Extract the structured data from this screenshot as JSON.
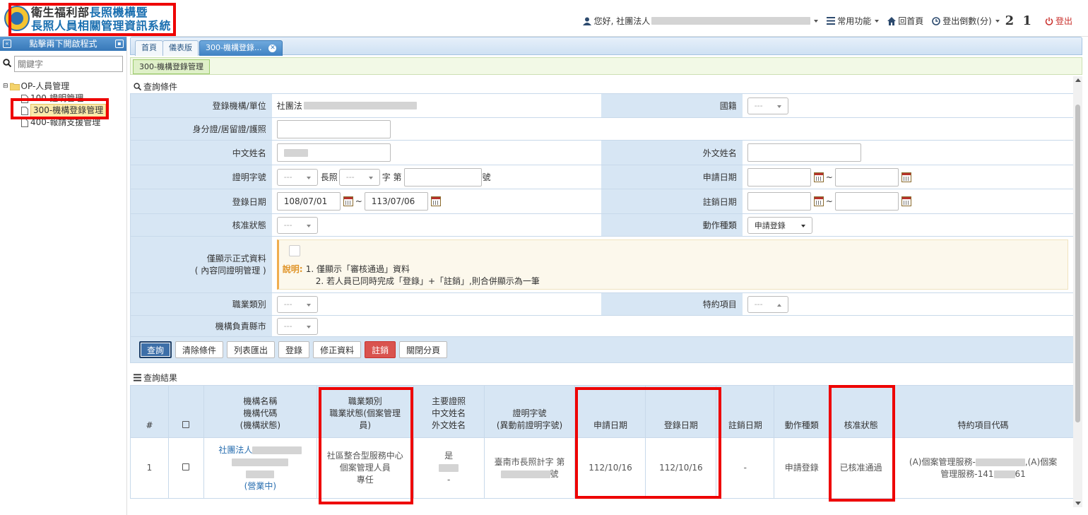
{
  "app": {
    "title_line1_a": "衛生福利部",
    "title_line1_b": "長照機構暨",
    "title_line2": "長照人員相關管理資訊系統"
  },
  "topnav": {
    "greeting": "您好, 社團法人",
    "common_functions": "常用功能",
    "home": "回首頁",
    "logout_countdown_label": "登出倒數(分)",
    "countdown": "2 1",
    "logout": "登出"
  },
  "sidebar": {
    "header": "點擊兩下開啟程式",
    "search_placeholder": "關鍵字",
    "tree": [
      {
        "label": "OP-人員管理"
      },
      {
        "label": "100-證明管理"
      },
      {
        "label": "300-機構登錄管理"
      },
      {
        "label": "400-報請支援管理"
      }
    ]
  },
  "tabs": [
    {
      "label": "首頁"
    },
    {
      "label": "儀表版"
    },
    {
      "label": "300-機構登錄..."
    }
  ],
  "subtab": "300-機構登錄管理",
  "query_section_title": "查詢條件",
  "form": {
    "org_label": "登錄機構/單位",
    "org_value_prefix": "社團法",
    "nationality_label": "國籍",
    "id_label": "身分證/居留證/護照",
    "cname_label": "中文姓名",
    "fname_label": "外文姓名",
    "cert_label": "證明字號",
    "cert_longzhao": "長照",
    "cert_zi": "字 第",
    "cert_hao": "號",
    "apply_date_label": "申請日期",
    "reg_date_label": "登錄日期",
    "reg_date_from": "108/07/01",
    "reg_date_to": "113/07/06",
    "cancel_date_label": "註銷日期",
    "approval_label": "核准狀態",
    "action_type_label": "動作種類",
    "action_type_value": "申請登錄",
    "formal_label_1": "僅顯示正式資料",
    "formal_label_2": "( 內容同證明管理 )",
    "note_title": "說明:",
    "note_line1": "1. 僅顯示「審核通過」資料",
    "note_line2": "2. 若人員已同時完成「登錄」+「註銷」,則合併顯示為一筆",
    "occupation_label": "職業類別",
    "special_label": "特約項目",
    "county_label": "機構負責縣市",
    "select_placeholder": "---",
    "tilde": "~"
  },
  "buttons": {
    "query": "查詢",
    "clear": "清除條件",
    "export": "列表匯出",
    "register": "登錄",
    "edit": "修正資料",
    "cancel": "註銷",
    "close_tab": "關閉分頁"
  },
  "results_section_title": "查詢結果",
  "table": {
    "headers": {
      "num": "#",
      "org_1": "機構名稱",
      "org_2": "機構代碼",
      "org_3": "(機構狀態)",
      "occ_1": "職業類別",
      "occ_2": "職業狀態(個案管理",
      "occ_3": "員)",
      "main_1": "主要證照",
      "main_2": "中文姓名",
      "main_3": "外文姓名",
      "cert_1": "證明字號",
      "cert_2": "(異動前證明字號)",
      "apply": "申請日期",
      "reg": "登錄日期",
      "cancel": "註銷日期",
      "action": "動作種類",
      "approval": "核准狀態",
      "special": "特約項目代碼"
    },
    "rows": [
      {
        "num": "1",
        "org_name_prefix": "社團法人",
        "org_status": "(營業中)",
        "occ_1": "社區整合型服務中心",
        "occ_2": "個案管理人員",
        "occ_3": "專任",
        "main_license": "是",
        "foreign_name": "-",
        "cert_prefix": "臺南市長照計字 第",
        "cert_suffix": "號",
        "apply_date": "112/10/16",
        "reg_date": "112/10/16",
        "cancel_date": "-",
        "action": "申請登錄",
        "approval": "已核准通過",
        "special_1a": "(A)個案管理服務-",
        "special_1b": ",(A)個案",
        "special_2a": "管理服務-141",
        "special_2b": "61"
      }
    ]
  }
}
